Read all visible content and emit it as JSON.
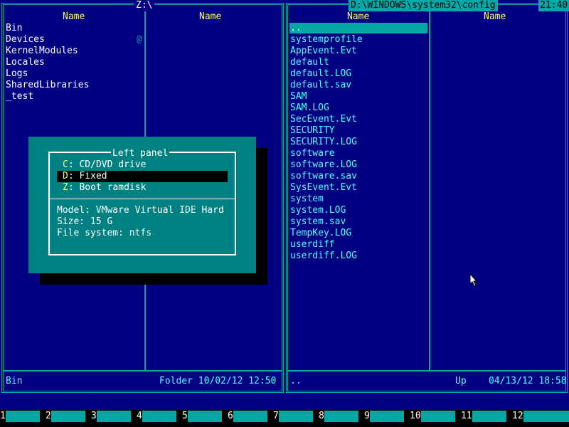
{
  "left_panel": {
    "path": "Z:\\",
    "col1_header": "Name",
    "col2_header": "Name",
    "files": [
      "Bin",
      "Devices",
      "KernelModules",
      "Locales",
      "Logs",
      "SharedLibraries",
      "_test"
    ],
    "devices_marker": "@",
    "status_name": "Bin",
    "status_info": "Folder 10/02/12 12:50"
  },
  "right_panel": {
    "path": "D:\\WINDOWS\\system32\\config",
    "clock": "21:40",
    "col1_header": "Name",
    "col2_header": "Name",
    "files": [
      "..",
      "systemprofile",
      "AppEvent.Evt",
      "default",
      "default.LOG",
      "default.sav",
      "SAM",
      "SAM.LOG",
      "SecEvent.Evt",
      "SECURITY",
      "SECURITY.LOG",
      "software",
      "software.LOG",
      "software.sav",
      "SysEvent.Evt",
      "system",
      "system.LOG",
      "system.sav",
      "TempKey.LOG",
      "userdiff",
      "userdiff.LOG"
    ],
    "status_name": "..",
    "status_info": "Up    04/13/12 18:58"
  },
  "dialog": {
    "title": "Left panel",
    "drives": [
      {
        "letter": "C",
        "label": ": CD/DVD drive"
      },
      {
        "letter": "D",
        "label": ": Fixed"
      },
      {
        "letter": "Z",
        "label": ": Boot ramdisk"
      }
    ],
    "selected_index": 1,
    "model": "Model: VMware Virtual IDE Hard",
    "size": "Size: 15 G",
    "filesystem": "File system: ntfs"
  },
  "function_keys": [
    "1",
    "2",
    "3",
    "4",
    "5",
    "6",
    "7",
    "8",
    "9",
    "10",
    "11",
    "12"
  ],
  "colors": {
    "background": "#000080",
    "frame": "#00A8A8",
    "header": "#FFFF55",
    "dialog": "#008080",
    "file_text_right": "#55FFFF"
  }
}
